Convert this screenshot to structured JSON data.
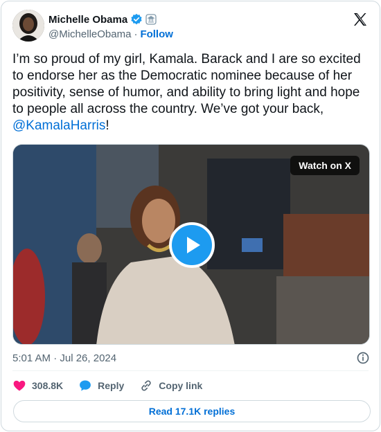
{
  "user": {
    "display_name": "Michelle Obama",
    "handle": "@MichelleObama",
    "separator": "·",
    "follow_label": "Follow"
  },
  "tweet": {
    "text": "I’m so proud of my girl, Kamala. Barack and I are so excited to endorse her as the Democratic nominee because of her positivity, sense of humor, and ability to bring light and hope to people all across the country. We’ve got your back, ",
    "mention": "@KamalaHarris",
    "trailing": "!"
  },
  "media": {
    "watch_label": "Watch on X"
  },
  "meta": {
    "timestamp": "5:01 AM · Jul 26, 2024"
  },
  "actions": {
    "likes": "308.8K",
    "reply_label": "Reply",
    "copy_label": "Copy link"
  },
  "replies_button": "Read 17.1K replies",
  "colors": {
    "accent": "#1d9bf0",
    "link": "#006fd6",
    "like": "#f91880",
    "gov_badge": "#829aab"
  },
  "icons": [
    "verified-badge-icon",
    "government-badge-icon",
    "x-logo-icon",
    "play-icon",
    "info-icon",
    "heart-icon",
    "reply-bubble-icon",
    "link-icon"
  ]
}
